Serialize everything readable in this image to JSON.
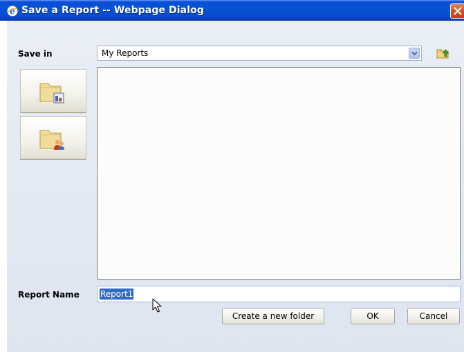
{
  "window": {
    "title": "Save a Report -- Webpage Dialog",
    "close_icon": "close-icon"
  },
  "save_in": {
    "label": "Save in",
    "selected": "My Reports",
    "up_icon": "up-one-level-folder-icon"
  },
  "sidebar": {
    "items": [
      {
        "name": "my-reports-folder",
        "icon": "folder-with-report-icon"
      },
      {
        "name": "shared-reports-folder",
        "icon": "folder-with-users-icon"
      }
    ]
  },
  "file_list": {
    "items": []
  },
  "report_name": {
    "label": "Report Name",
    "value": "Report1"
  },
  "buttons": {
    "new_folder": "Create a new folder",
    "ok": "OK",
    "cancel": "Cancel"
  },
  "colors": {
    "titlebar": "#0753d4",
    "panel": "#e4eaf3",
    "selection": "#316ac5",
    "close": "#d4532a"
  }
}
